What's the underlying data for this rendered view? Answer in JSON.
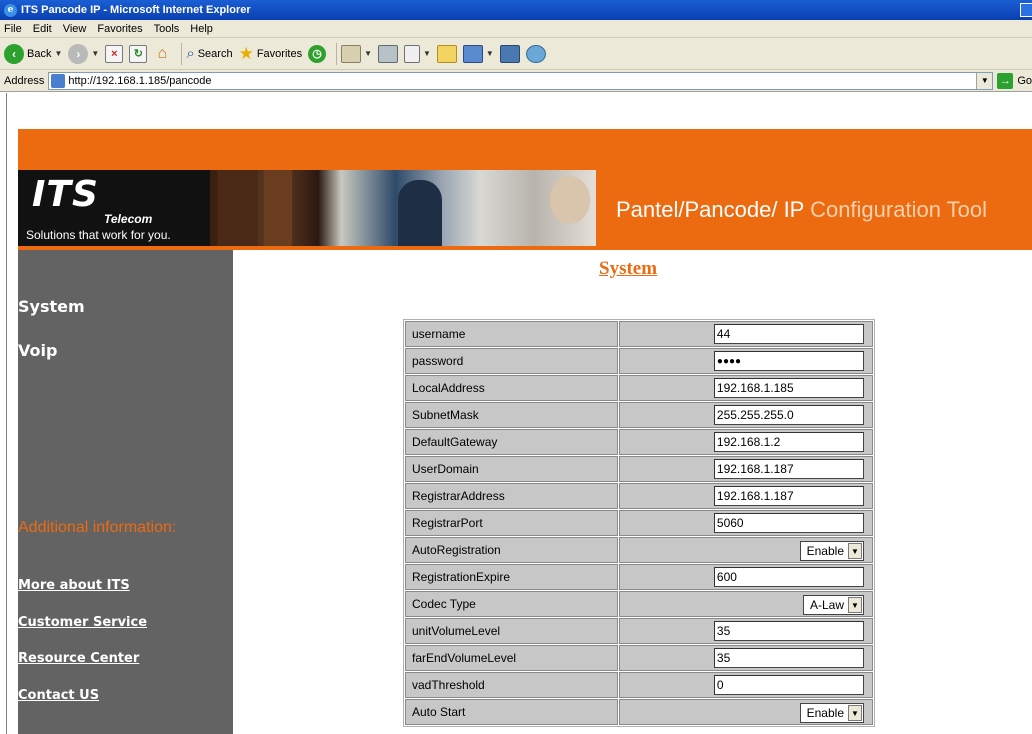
{
  "browser": {
    "title": "ITS Pancode IP - Microsoft Internet Explorer",
    "menu": [
      "File",
      "Edit",
      "View",
      "Favorites",
      "Tools",
      "Help"
    ],
    "toolbar": {
      "back": "Back",
      "search": "Search",
      "favorites": "Favorites"
    },
    "address_label": "Address",
    "url": "http://192.168.1.185/pancode",
    "go_label": "Go"
  },
  "banner": {
    "logo_its": "ITS",
    "logo_telecom": "Telecom",
    "tagline": "Solutions that work for you.",
    "title_main": "Pantel/Pancode/ IP ",
    "title_accent": "Configuration Tool",
    "accent_color": "#ec6a10"
  },
  "sidebar": {
    "items": [
      "System",
      "Voip"
    ],
    "additional_label": "Additional information:",
    "links": [
      "More about ITS",
      "Customer Service",
      "Resource Center",
      "Contact US"
    ]
  },
  "section_title": "System",
  "fields": [
    {
      "label": "username",
      "type": "text",
      "value": "44"
    },
    {
      "label": "password",
      "type": "password",
      "value": "●●●●"
    },
    {
      "label": "LocalAddress",
      "type": "text",
      "value": "192.168.1.185"
    },
    {
      "label": "SubnetMask",
      "type": "text",
      "value": "255.255.255.0"
    },
    {
      "label": "DefaultGateway",
      "type": "text",
      "value": "192.168.1.2"
    },
    {
      "label": "UserDomain",
      "type": "text",
      "value": "192.168.1.187"
    },
    {
      "label": "RegistrarAddress",
      "type": "text",
      "value": "192.168.1.187"
    },
    {
      "label": "RegistrarPort",
      "type": "text",
      "value": "5060"
    },
    {
      "label": "AutoRegistration",
      "type": "select",
      "value": "Enable"
    },
    {
      "label": "RegistrationExpire",
      "type": "text",
      "value": "600"
    },
    {
      "label": "Codec Type",
      "type": "select",
      "value": "A-Law"
    },
    {
      "label": "unitVolumeLevel",
      "type": "text",
      "value": "35"
    },
    {
      "label": "farEndVolumeLevel",
      "type": "text",
      "value": "35"
    },
    {
      "label": "vadThreshold",
      "type": "text",
      "value": "0"
    },
    {
      "label": "Auto Start",
      "type": "select",
      "value": "Enable"
    }
  ]
}
